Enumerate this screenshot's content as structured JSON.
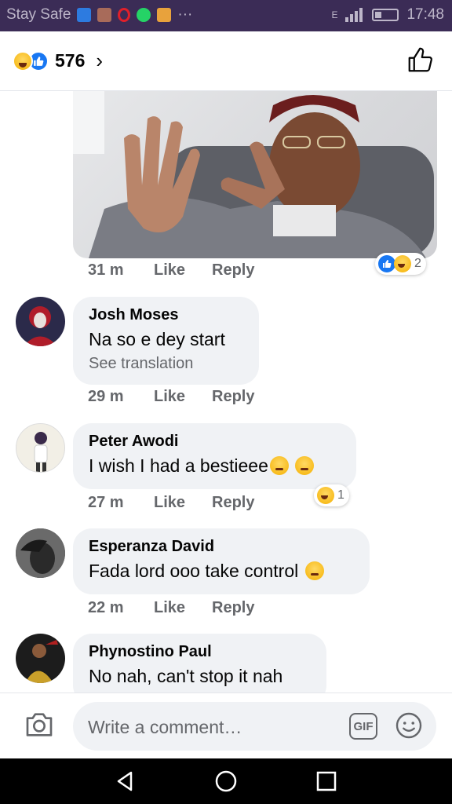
{
  "status_bar": {
    "carrier": "Stay Safe",
    "time": "17:48",
    "signal": "E",
    "overflow": "···"
  },
  "header": {
    "reaction_count": "576",
    "chevron": "›"
  },
  "top_comment": {
    "time": "31 m",
    "like_label": "Like",
    "reply_label": "Reply",
    "reaction_count": "2"
  },
  "comments": [
    {
      "name": "Josh Moses",
      "text": "Na so e dey start",
      "translate": "See translation",
      "time": "29 m",
      "like_label": "Like",
      "reply_label": "Reply"
    },
    {
      "name": "Peter Awodi",
      "text": "I wish I had a bestieee",
      "time": "27 m",
      "like_label": "Like",
      "reply_label": "Reply",
      "reaction_count": "1"
    },
    {
      "name": "Esperanza David",
      "text": "Fada lord ooo take control",
      "time": "22 m",
      "like_label": "Like",
      "reply_label": "Reply"
    },
    {
      "name": "Phynostino Paul",
      "text": "No nah,  can't stop it nah"
    }
  ],
  "composer": {
    "placeholder": "Write a comment…",
    "gif_label": "GIF"
  },
  "colors": {
    "status_bar": "#3b2c56",
    "accent": "#1877f2",
    "bubble": "#f0f2f5",
    "muted_text": "#65676b"
  },
  "icons": [
    "laugh-emoji",
    "like-emoji",
    "chevron-right-icon",
    "thumbs-up-icon",
    "camera-icon",
    "gif-icon",
    "smiley-icon",
    "back-icon",
    "home-icon",
    "recents-icon"
  ]
}
